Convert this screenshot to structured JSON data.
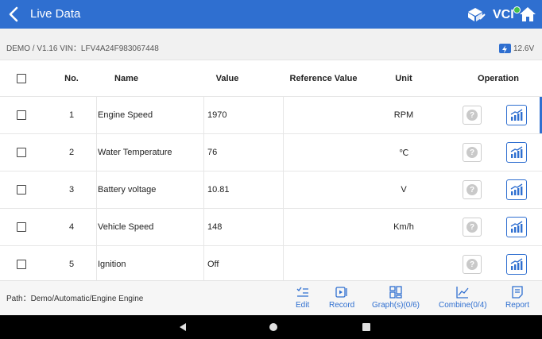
{
  "header": {
    "title": "Live Data",
    "vci_label": "VCI"
  },
  "info": {
    "device_vin": "DEMO / V1.16  VIN：LFV4A24F983067448",
    "battery_voltage": "12.6V"
  },
  "table": {
    "columns": [
      "No.",
      "Name",
      "Value",
      "Reference Value",
      "Unit",
      "Operation"
    ],
    "rows": [
      {
        "no": "1",
        "name": "Engine Speed",
        "value": "1970",
        "reference": "",
        "unit": "RPM"
      },
      {
        "no": "2",
        "name": "Water Temperature",
        "value": "76",
        "reference": "",
        "unit": "℃"
      },
      {
        "no": "3",
        "name": "Battery voltage",
        "value": "10.81",
        "reference": "",
        "unit": "V"
      },
      {
        "no": "4",
        "name": "Vehicle Speed",
        "value": "148",
        "reference": "",
        "unit": "Km/h"
      },
      {
        "no": "5",
        "name": "Ignition",
        "value": "Off",
        "reference": "",
        "unit": ""
      }
    ]
  },
  "footer": {
    "path": "Path：Demo/Automatic/Engine Engine",
    "buttons": {
      "edit": "Edit",
      "record": "Record",
      "graph": "Graph(s)(0/6)",
      "combine": "Combine(0/4)",
      "report": "Report"
    }
  },
  "colors": {
    "accent": "#2f6fd0",
    "vci_status": "#43c24a"
  },
  "icons": [
    "back-arrow-icon",
    "car-icon",
    "home-icon",
    "battery-icon",
    "help-icon",
    "graph-icon",
    "edit-icon",
    "record-icon",
    "grid-icon",
    "combine-icon",
    "report-icon"
  ]
}
